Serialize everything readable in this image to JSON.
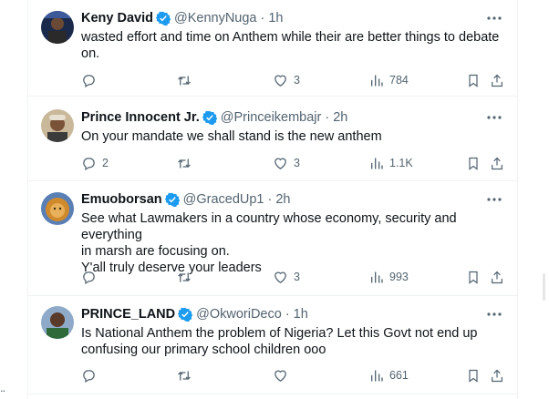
{
  "tweets": [
    {
      "name": "Keny David",
      "handle": "@KennyNuga",
      "time": "1h",
      "text": "wasted effort and time on Anthem while their are better things to debate\non.",
      "replies": "",
      "retweets": "",
      "likes": "3",
      "views": "784",
      "avatar_icon": "avatar-keny"
    },
    {
      "name": "Prince Innocent Jr.",
      "handle": "@Princeikembajr",
      "time": "2h",
      "text": "On your mandate we shall stand is the new anthem",
      "replies": "2",
      "retweets": "",
      "likes": "3",
      "views": "1.1K",
      "avatar_icon": "avatar-prince-innocent"
    },
    {
      "name": "Emuoborsan",
      "handle": "@GracedUp1",
      "time": "2h",
      "text": "See what Lawmakers in a country whose economy, security and everything\nin marsh are focusing on.\nY'all truly deserve your leaders",
      "replies": "",
      "retweets": "",
      "likes": "3",
      "views": "993",
      "avatar_icon": "avatar-lion"
    },
    {
      "name": "PRINCE_LAND",
      "handle": "@OkworiDeco",
      "time": "1h",
      "text": "Is National Anthem the problem of Nigeria? Let this Govt not end up\nconfusing our primary school children ooo",
      "replies": "",
      "retweets": "",
      "likes": "",
      "views": "661",
      "avatar_icon": "avatar-prince-land"
    }
  ],
  "stray_text": "..",
  "colors": {
    "text": "#0f1419",
    "muted": "#536471",
    "verified": "#1d9bf0",
    "border": "#eff3f4"
  }
}
